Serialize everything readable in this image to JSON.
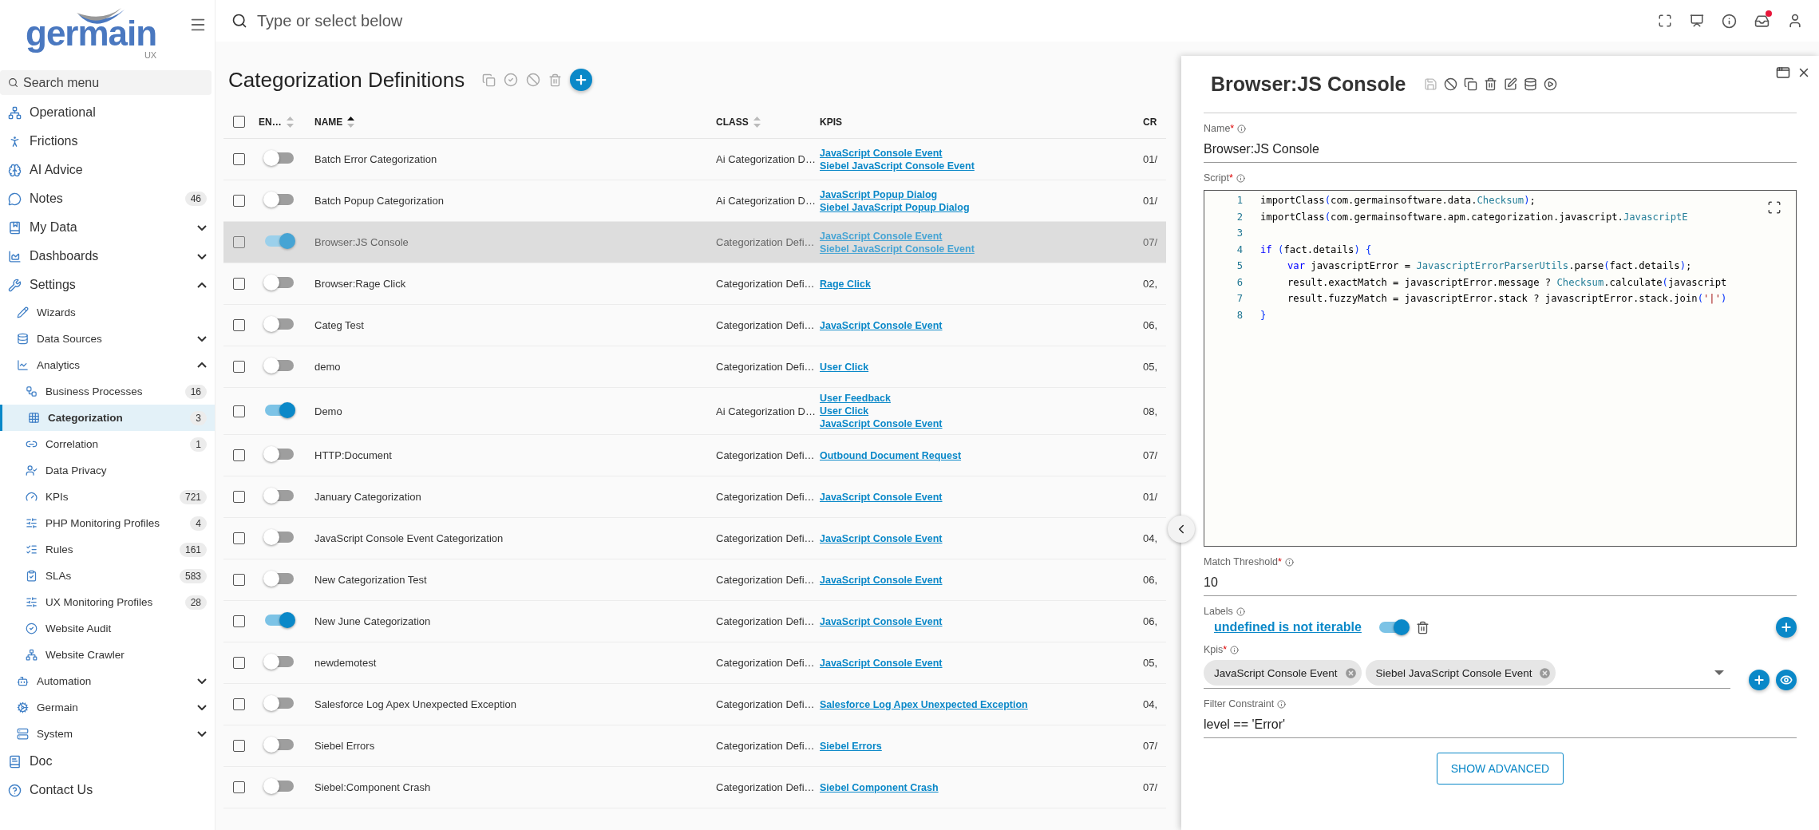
{
  "logo": {
    "name": "germain",
    "sub": "UX"
  },
  "sidebar": {
    "search_placeholder": "Search menu",
    "items": [
      {
        "label": "Operational",
        "selected": false
      },
      {
        "label": "Frictions",
        "selected": false
      },
      {
        "label": "AI Advice",
        "selected": false
      },
      {
        "label": "Notes",
        "badge": "46",
        "selected": false
      },
      {
        "label": "My Data",
        "expanded": false,
        "selected": false
      },
      {
        "label": "Dashboards",
        "expanded": false,
        "selected": false
      },
      {
        "label": "Settings",
        "expanded": true,
        "selected": false,
        "children": [
          {
            "label": "Wizards",
            "selected": false
          },
          {
            "label": "Data Sources",
            "expanded": false,
            "selected": false
          },
          {
            "label": "Analytics",
            "expanded": true,
            "selected": false,
            "children": [
              {
                "label": "Business Processes",
                "badge": "16",
                "selected": false
              },
              {
                "label": "Categorization",
                "badge": "3",
                "selected": true
              },
              {
                "label": "Correlation",
                "badge": "1",
                "selected": false
              },
              {
                "label": "Data Privacy",
                "selected": false
              },
              {
                "label": "KPIs",
                "badge": "721",
                "selected": false
              },
              {
                "label": "PHP Monitoring Profiles",
                "badge": "4",
                "selected": false
              },
              {
                "label": "Rules",
                "badge": "161",
                "selected": false
              },
              {
                "label": "SLAs",
                "badge": "583",
                "selected": false
              },
              {
                "label": "UX Monitoring Profiles",
                "badge": "28",
                "selected": false
              },
              {
                "label": "Website Audit",
                "selected": false
              },
              {
                "label": "Website Crawler",
                "selected": false
              }
            ]
          },
          {
            "label": "Automation",
            "expanded": false,
            "selected": false
          },
          {
            "label": "Germain",
            "expanded": false,
            "selected": false
          },
          {
            "label": "System",
            "expanded": false,
            "selected": false
          }
        ]
      },
      {
        "label": "Doc",
        "selected": false
      },
      {
        "label": "Contact Us",
        "selected": false
      }
    ]
  },
  "topbar": {
    "search_placeholder": "Type or select below",
    "notification": true
  },
  "page": {
    "title": "Categorization Definitions"
  },
  "table": {
    "all_checked": false,
    "columns": [
      {
        "label": "EN…",
        "sorted": false
      },
      {
        "label": "NAME",
        "sorted": true
      },
      {
        "label": "CLASS",
        "sorted": false
      },
      {
        "label": "KPIS"
      },
      {
        "label": "CR"
      }
    ],
    "rows": [
      {
        "enabled": false,
        "checked": false,
        "selected": false,
        "name": "Batch Error Categorization",
        "class": "Ai Categorization D…",
        "kpis": [
          "JavaScript Console Event",
          "Siebel JavaScript Console Event"
        ],
        "created": "01/"
      },
      {
        "enabled": false,
        "checked": false,
        "selected": false,
        "name": "Batch Popup Categorization",
        "class": "Ai Categorization D…",
        "kpis": [
          "JavaScript Popup Dialog",
          "Siebel JavaScript Popup Dialog"
        ],
        "created": "01/"
      },
      {
        "enabled": true,
        "checked": false,
        "selected": true,
        "name": "Browser:JS Console",
        "class": "Categorization Defi…",
        "kpis": [
          "JavaScript Console Event",
          "Siebel JavaScript Console Event"
        ],
        "created": "07/"
      },
      {
        "enabled": false,
        "checked": false,
        "selected": false,
        "name": "Browser:Rage Click",
        "class": "Categorization Defi…",
        "kpis": [
          "Rage Click"
        ],
        "created": "02,"
      },
      {
        "enabled": false,
        "checked": false,
        "selected": false,
        "name": "Categ Test",
        "class": "Categorization Defi…",
        "kpis": [
          "JavaScript Console Event"
        ],
        "created": "06,"
      },
      {
        "enabled": false,
        "checked": false,
        "selected": false,
        "name": "demo",
        "class": "Categorization Defi…",
        "kpis": [
          "User Click"
        ],
        "created": "05,"
      },
      {
        "enabled": true,
        "checked": false,
        "selected": false,
        "name": "Demo",
        "class": "Ai Categorization D…",
        "kpis": [
          "User Feedback",
          "User Click",
          "JavaScript Console Event"
        ],
        "created": "08,"
      },
      {
        "enabled": false,
        "checked": false,
        "selected": false,
        "name": "HTTP:Document",
        "class": "Categorization Defi…",
        "kpis": [
          "Outbound Document Request"
        ],
        "created": "07/"
      },
      {
        "enabled": false,
        "checked": false,
        "selected": false,
        "name": "January Categorization",
        "class": "Categorization Defi…",
        "kpis": [
          "JavaScript Console Event"
        ],
        "created": "01/"
      },
      {
        "enabled": false,
        "checked": false,
        "selected": false,
        "name": "JavaScript Console Event Categorization",
        "class": "Categorization Defi…",
        "kpis": [
          "JavaScript Console Event"
        ],
        "created": "04,"
      },
      {
        "enabled": false,
        "checked": false,
        "selected": false,
        "name": "New Categorization Test",
        "class": "Categorization Defi…",
        "kpis": [
          "JavaScript Console Event"
        ],
        "created": "06,"
      },
      {
        "enabled": true,
        "checked": false,
        "selected": false,
        "name": "New June Categorization",
        "class": "Categorization Defi…",
        "kpis": [
          "JavaScript Console Event"
        ],
        "created": "06,"
      },
      {
        "enabled": false,
        "checked": false,
        "selected": false,
        "name": "newdemotest",
        "class": "Categorization Defi…",
        "kpis": [
          "JavaScript Console Event"
        ],
        "created": "05,"
      },
      {
        "enabled": false,
        "checked": false,
        "selected": false,
        "name": "Salesforce Log Apex Unexpected Exception",
        "class": "Categorization Defi…",
        "kpis": [
          "Salesforce Log Apex Unexpected Exception"
        ],
        "created": "04,"
      },
      {
        "enabled": false,
        "checked": false,
        "selected": false,
        "name": "Siebel Errors",
        "class": "Categorization Defi…",
        "kpis": [
          "Siebel Errors"
        ],
        "created": "07/"
      },
      {
        "enabled": false,
        "checked": false,
        "selected": false,
        "name": "Siebel:Component Crash",
        "class": "Categorization Defi…",
        "kpis": [
          "Siebel Component Crash"
        ],
        "created": "07/"
      }
    ]
  },
  "panel": {
    "title": "Browser:JS Console",
    "name_field": {
      "label": "Name",
      "required": "*",
      "value": "Browser:JS Console"
    },
    "script": {
      "label": "Script",
      "required": "*",
      "lines": [
        {
          "number": "1",
          "indent": false,
          "tokens": [
            {
              "text": "importClass",
              "kind": "plain"
            },
            {
              "text": "(",
              "kind": "bracket"
            },
            {
              "text": "com.germainsoftware.data.",
              "kind": "plain"
            },
            {
              "text": "Checksum",
              "kind": "type"
            },
            {
              "text": ")",
              "kind": "bracket"
            },
            {
              "text": ";",
              "kind": "plain"
            }
          ]
        },
        {
          "number": "2",
          "indent": false,
          "tokens": [
            {
              "text": "importClass",
              "kind": "plain"
            },
            {
              "text": "(",
              "kind": "bracket"
            },
            {
              "text": "com.germainsoftware.apm.categorization.javascript.",
              "kind": "plain"
            },
            {
              "text": "JavascriptE",
              "kind": "type"
            }
          ]
        },
        {
          "number": "3"
        },
        {
          "number": "4",
          "indent": false,
          "tokens": [
            {
              "text": "if",
              "kind": "keyword"
            },
            {
              "text": " (",
              "kind": "bracket"
            },
            {
              "text": "fact.details",
              "kind": "plain"
            },
            {
              "text": ") {",
              "kind": "bracket"
            }
          ]
        },
        {
          "number": "5",
          "indent": true,
          "tokens": [
            {
              "text": "var",
              "kind": "keyword"
            },
            {
              "text": " javascriptError = ",
              "kind": "plain"
            },
            {
              "text": "JavascriptErrorParserUtils",
              "kind": "type"
            },
            {
              "text": ".parse",
              "kind": "plain"
            },
            {
              "text": "(",
              "kind": "bracket"
            },
            {
              "text": "fact.details",
              "kind": "plain"
            },
            {
              "text": ")",
              "kind": "bracket"
            },
            {
              "text": ";",
              "kind": "plain"
            }
          ]
        },
        {
          "number": "6",
          "indent": true,
          "tokens": [
            {
              "text": "result.exactMatch = javascriptError.message ? ",
              "kind": "plain"
            },
            {
              "text": "Checksum",
              "kind": "type"
            },
            {
              "text": ".calculate",
              "kind": "plain"
            },
            {
              "text": "(",
              "kind": "bracket"
            },
            {
              "text": "javascript",
              "kind": "plain"
            }
          ]
        },
        {
          "number": "7",
          "indent": true,
          "tokens": [
            {
              "text": "result.fuzzyMatch = javascriptError.stack ? javascriptError.stack.join",
              "kind": "plain"
            },
            {
              "text": "(",
              "kind": "bracket"
            },
            {
              "text": "'|'",
              "kind": "string"
            },
            {
              "text": ")",
              "kind": "bracket"
            }
          ]
        },
        {
          "number": "8",
          "indent": false,
          "tokens": [
            {
              "text": "}",
              "kind": "bracket"
            }
          ]
        }
      ]
    },
    "match_threshold": {
      "label": "Match Threshold",
      "required": "*",
      "value": "10"
    },
    "labels": {
      "label": "Labels",
      "items": [
        {
          "text": "undefined is not iterable",
          "on": true
        }
      ]
    },
    "kpis": {
      "label": "Kpis",
      "required": "*",
      "chips": [
        "JavaScript Console Event",
        "Siebel JavaScript Console Event"
      ]
    },
    "filter_constraint": {
      "label": "Filter Constraint",
      "value": "level == 'Error'"
    },
    "button": "SHOW ADVANCED"
  }
}
